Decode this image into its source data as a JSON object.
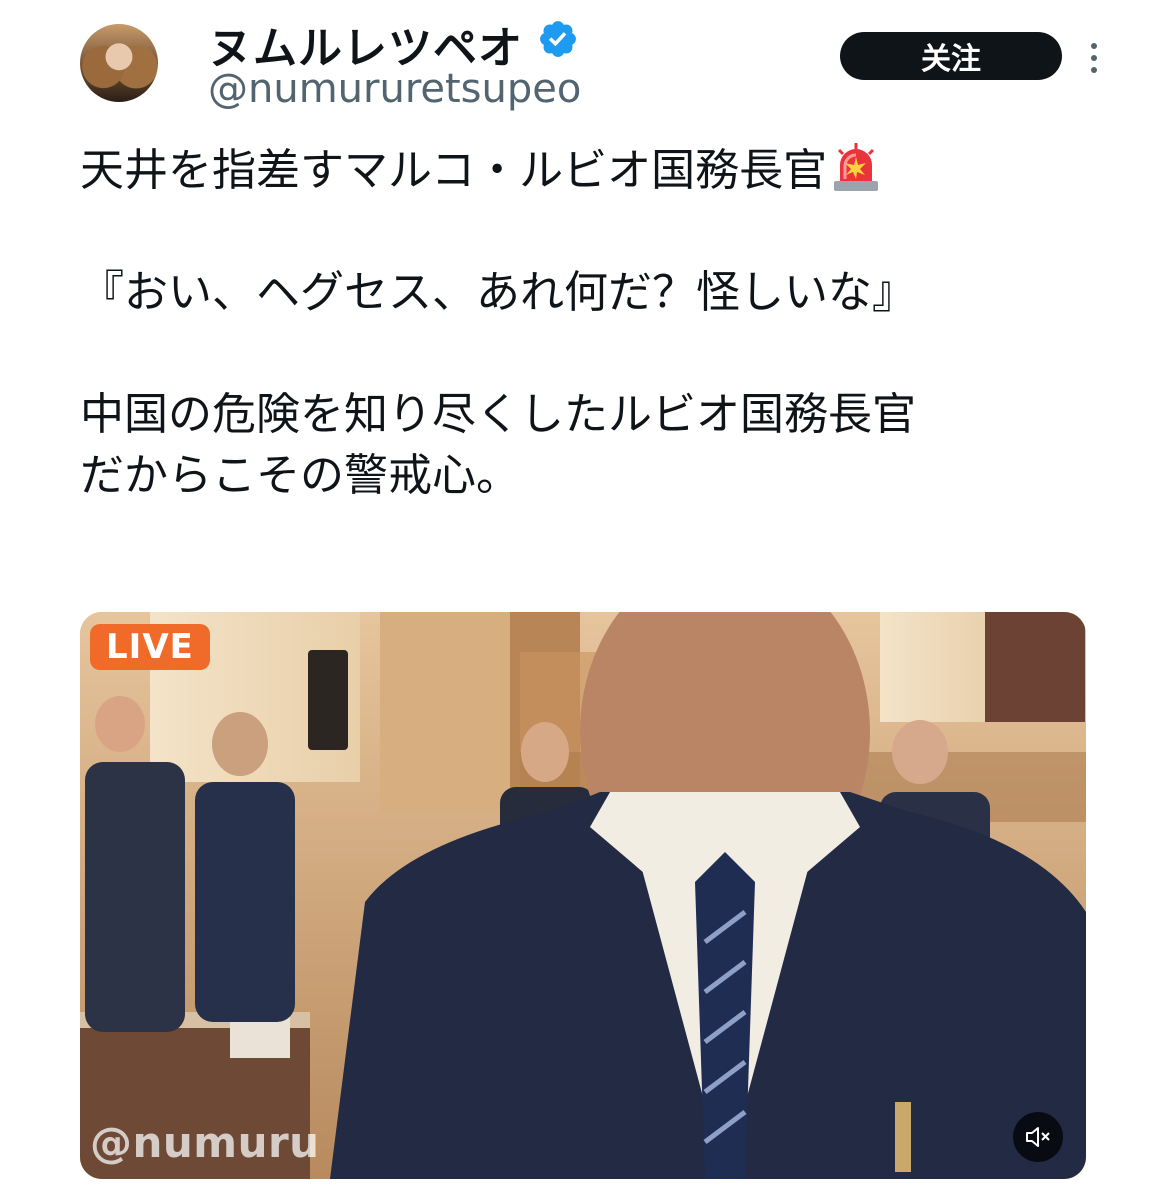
{
  "author": {
    "display_name": "ヌムルレツペオ",
    "handle": "@numururetsupeo",
    "verified": true,
    "avatar": "profile-photo"
  },
  "actions": {
    "follow_label": "关注",
    "more_icon": "more-vertical-icon"
  },
  "tweet": {
    "line1": "天井を指差すマルコ・ルビオ国務長官",
    "line1_emoji": "police-siren-icon",
    "line2": "『おい、ヘグセス、あれ何だ？怪しいな』",
    "line3": "中国の危険を知り尽くしたルビオ国務長官",
    "line4": "だからこその警戒心。"
  },
  "media": {
    "type": "video",
    "live_badge": "LIVE",
    "watermark": "@numuru",
    "mute_icon": "speaker-muted-icon"
  },
  "colors": {
    "text": "#0f1419",
    "secondary_text": "#536471",
    "verified_blue": "#1d9bf0",
    "live_orange": "#f06a2a"
  }
}
